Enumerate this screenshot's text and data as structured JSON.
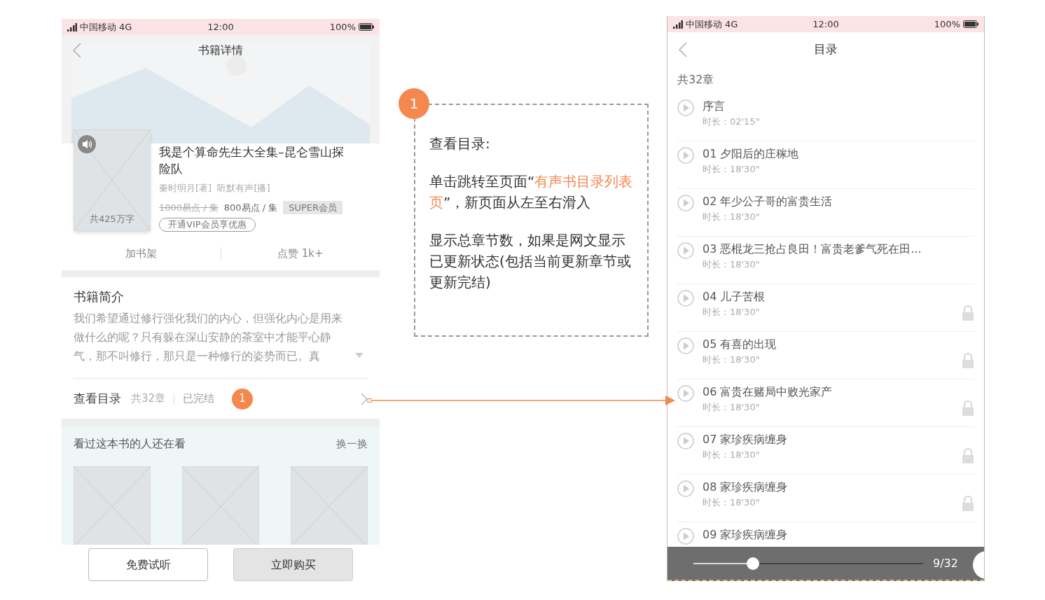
{
  "detail_screen": {
    "status_bar": {
      "carrier": "中国移动",
      "network": "4G",
      "time": "12:00",
      "battery": "100%"
    },
    "title": "书籍详情",
    "book": {
      "title": "我是个算命先生大全集–昆仑雪山探险队",
      "word_count": "共425万字",
      "authors": "秦时明月[著]  听默有声[播]",
      "original_price": "1000易点 / 集",
      "price": "800易点 / 集",
      "member_tag": "SUPER会员",
      "vip_offer": "开通VIP会员享优惠"
    },
    "actions": [
      "加书架",
      "点赞 1k+"
    ],
    "intro": {
      "title": "书籍简介",
      "text": "我们希望通过修行强化我们的内心，但强化内心是用来做什么的呢？只有躲在深山安静的茶室中才能平心静气，那不叫修行，那只是一种修行的姿势而已。真"
    },
    "catalog": {
      "label": "查看目录",
      "count": "共32章",
      "status": "已完结",
      "marker": "1"
    },
    "recommend": {
      "title": "看过这本书的人还在看",
      "refresh": "换一换"
    },
    "buttons": [
      {
        "label": "免费试听",
        "kind": "outline"
      },
      {
        "label": "立即购买",
        "kind": "filled"
      }
    ]
  },
  "annotation": {
    "marker": "1",
    "heading": "查看目录:",
    "paragraphs": [
      {
        "parts": [
          {
            "text": "单击跳转至页面“",
            "highlight": false
          },
          {
            "text": "有声书目录列表页",
            "highlight": true
          },
          {
            "text": "”，新页面从左至右滑入",
            "highlight": false
          }
        ]
      },
      {
        "parts": [
          {
            "text": "显示总章节数，如果是网文显示已更新状态(包括当前更新章节或更新完结)",
            "highlight": false
          }
        ]
      }
    ]
  },
  "catalog_screen": {
    "status_bar": {
      "carrier": "中国移动",
      "network": "4G",
      "time": "12:00",
      "battery": "100%"
    },
    "title": "目录",
    "count": "共32章",
    "chapters": [
      {
        "title": "序言",
        "duration": "时长：02'15\"",
        "locked": false
      },
      {
        "title": "01 夕阳后的庄稼地",
        "duration": "时长：18'30\"",
        "locked": false
      },
      {
        "title": "02 年少公子哥的富贵生活",
        "duration": "时长：18'30\"",
        "locked": false
      },
      {
        "title": "03 恶棍龙三抢占良田！富贵老爹气死在田...",
        "duration": "时长：18'30\"",
        "locked": false
      },
      {
        "title": "04 儿子苦根",
        "duration": "时长：18'30\"",
        "locked": true
      },
      {
        "title": "05 有喜的出现",
        "duration": "时长：18'30\"",
        "locked": true
      },
      {
        "title": "06 富贵在赌局中败光家产",
        "duration": "时长：18'30\"",
        "locked": true
      },
      {
        "title": "07 家珍疾病缠身",
        "duration": "时长：18'30\"",
        "locked": true
      },
      {
        "title": "08 家珍疾病缠身",
        "duration": "时长：18'30\"",
        "locked": true
      },
      {
        "title": "09 家珍疾病缠身",
        "locked": false
      }
    ],
    "progress": {
      "level": 0.26,
      "reading": "9/32"
    }
  }
}
